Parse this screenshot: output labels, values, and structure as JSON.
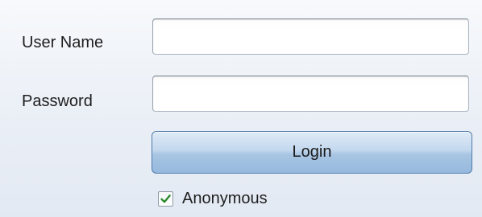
{
  "form": {
    "username_label": "User Name",
    "username_value": "",
    "password_label": "Password",
    "password_value": "",
    "login_label": "Login",
    "anonymous_label": "Anonymous",
    "anonymous_checked": true
  },
  "icons": {
    "checkbox_check": "checkmark-icon"
  },
  "colors": {
    "check": "#2a8a2a",
    "button_border": "#4f7ba8"
  }
}
